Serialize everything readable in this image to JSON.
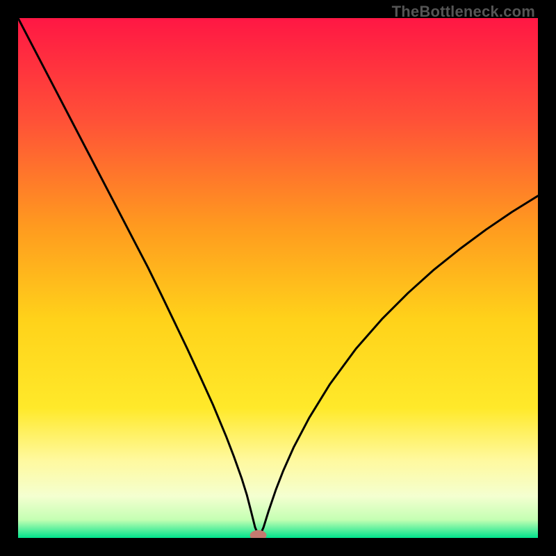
{
  "watermark": "TheBottleneck.com",
  "chart_data": {
    "type": "line",
    "title": "",
    "xlabel": "",
    "ylabel": "",
    "xlim": [
      0,
      100
    ],
    "ylim": [
      0,
      100
    ],
    "grid": false,
    "legend": false,
    "background_gradient": {
      "stops": [
        {
          "offset": 0.0,
          "color": "#ff1744"
        },
        {
          "offset": 0.2,
          "color": "#ff5237"
        },
        {
          "offset": 0.4,
          "color": "#ff9a1f"
        },
        {
          "offset": 0.58,
          "color": "#ffd21a"
        },
        {
          "offset": 0.75,
          "color": "#ffe92a"
        },
        {
          "offset": 0.85,
          "color": "#fff99e"
        },
        {
          "offset": 0.92,
          "color": "#f4ffd0"
        },
        {
          "offset": 0.965,
          "color": "#c4ffb3"
        },
        {
          "offset": 1.0,
          "color": "#00e38c"
        }
      ]
    },
    "series": [
      {
        "name": "bottleneck-curve",
        "color": "#000000",
        "stroke_width": 3,
        "x": [
          0.0,
          2.5,
          5.0,
          7.5,
          10.0,
          12.5,
          15.0,
          17.5,
          20.0,
          22.5,
          25.0,
          27.5,
          30.0,
          32.5,
          35.0,
          37.5,
          40.0,
          41.5,
          43.0,
          44.0,
          44.8,
          45.6,
          46.4,
          47.2,
          48.2,
          49.6,
          51.0,
          53.0,
          56.0,
          60.0,
          65.0,
          70.0,
          75.0,
          80.0,
          85.0,
          90.0,
          95.0,
          100.0
        ],
        "y": [
          100.0,
          95.2,
          90.4,
          85.6,
          80.8,
          76.0,
          71.2,
          66.4,
          61.6,
          56.8,
          52.0,
          46.9,
          41.7,
          36.5,
          31.1,
          25.6,
          19.6,
          15.7,
          11.5,
          8.3,
          5.2,
          2.0,
          0.2,
          2.0,
          5.2,
          9.3,
          12.9,
          17.4,
          23.1,
          29.6,
          36.4,
          42.1,
          47.1,
          51.6,
          55.6,
          59.3,
          62.7,
          65.8
        ]
      }
    ],
    "marker": {
      "name": "optimal-point",
      "x": 46.2,
      "y": 0.5,
      "rx": 1.6,
      "ry": 1.0,
      "fill": "#c47a70"
    }
  }
}
